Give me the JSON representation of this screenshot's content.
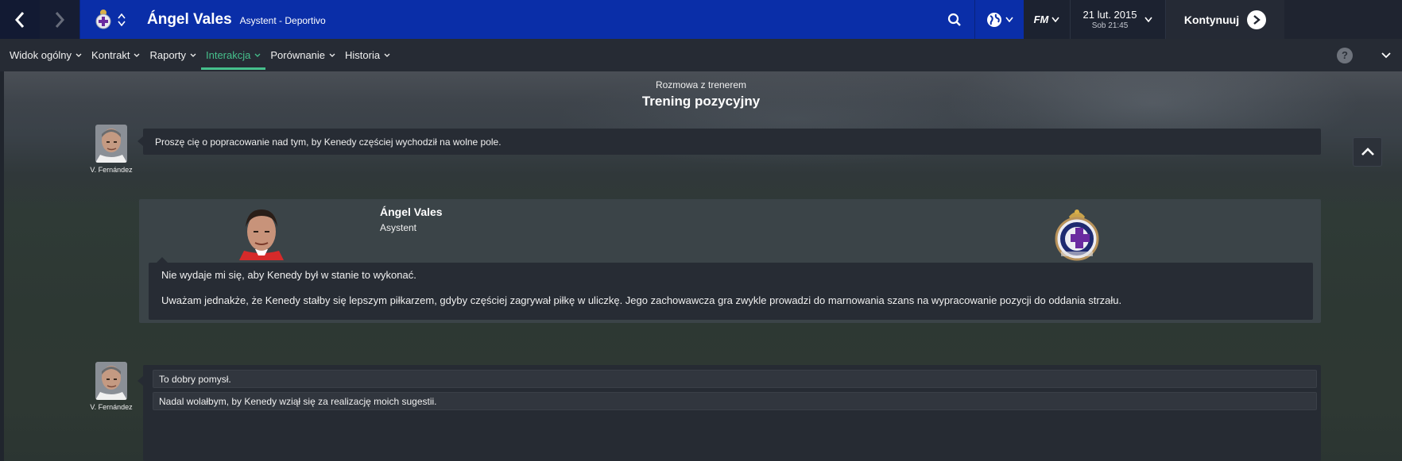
{
  "topbar": {
    "player_name": "Ángel Vales",
    "subtitle": "Asystent - Deportivo",
    "fm_label": "FM",
    "date": "21 lut. 2015",
    "time": "Sob 21:45",
    "continue_label": "Kontynuuj",
    "colors": {
      "bar": "#0a2ea8",
      "dark": "#1c2230"
    }
  },
  "subnav": {
    "tabs": [
      {
        "label": "Widok ogólny"
      },
      {
        "label": "Kontrakt"
      },
      {
        "label": "Raporty"
      },
      {
        "label": "Interakcja",
        "active": true
      },
      {
        "label": "Porównanie"
      },
      {
        "label": "Historia"
      }
    ],
    "help": "?",
    "accent": "#46c08c"
  },
  "conversation": {
    "subtitle": "Rozmowa z trenerem",
    "title": "Trening pozycyjny",
    "manager_name": "V. Fernández",
    "manager_message": "Proszę cię o popracowanie nad tym, by Kenedy częściej wychodził na wolne pole.",
    "responder": {
      "name": "Ángel Vales",
      "role": "Asystent",
      "reply_line1": "Nie wydaje mi się, aby Kenedy był w stanie to wykonać.",
      "reply_line2": "Uważam jednakże, że Kenedy stałby się lepszym piłkarzem, gdyby częściej zagrywał piłkę w uliczkę. Jego zachowawcza gra zwykle prowadzi do marnowania szans na wypracowanie pozycji do oddania strzału."
    },
    "answers": [
      "To dobry pomysł.",
      "Nadal wolałbym, by Kenedy wziął się za realizację moich sugestii."
    ]
  }
}
